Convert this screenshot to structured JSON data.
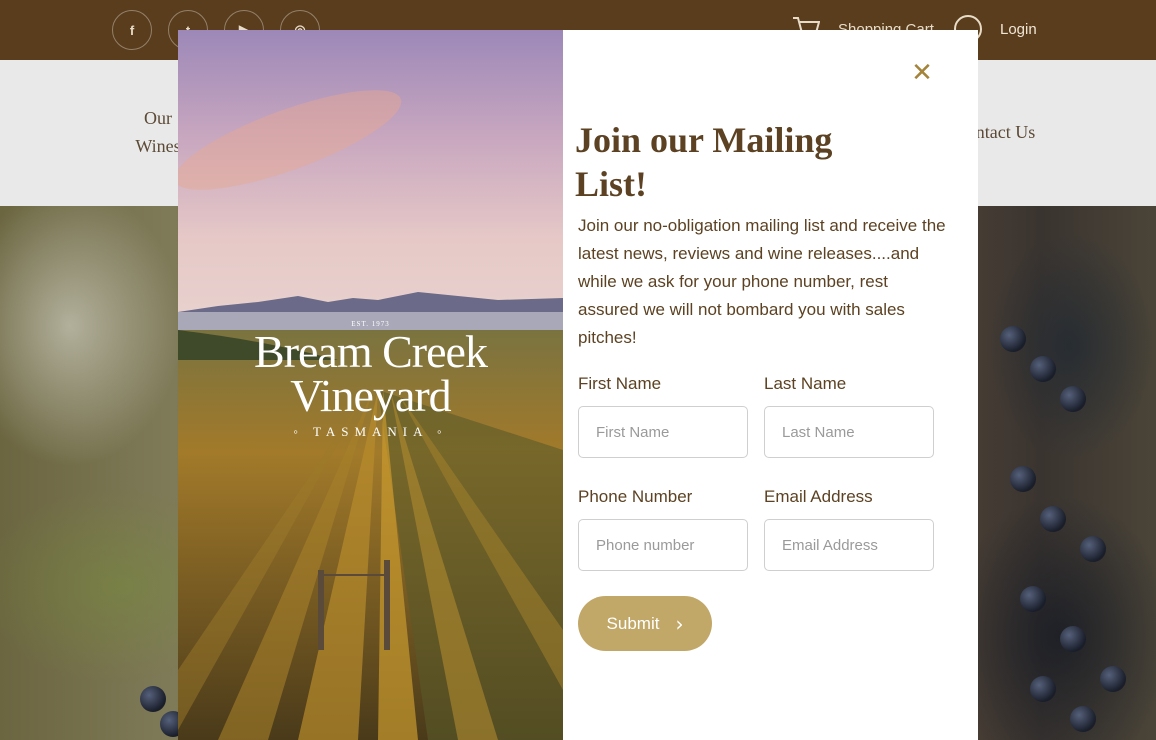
{
  "header": {
    "social_icons": [
      {
        "name": "facebook-icon",
        "glyph": "f"
      },
      {
        "name": "twitter-icon",
        "glyph": "t"
      },
      {
        "name": "youtube-icon",
        "glyph": "▶"
      },
      {
        "name": "instagram-icon",
        "glyph": "◎"
      }
    ],
    "cart_label": "Shopping Cart",
    "login_label": "Login"
  },
  "nav": {
    "items": [
      {
        "label": "Our Wines"
      },
      {
        "label": "Contact Us"
      }
    ]
  },
  "modal": {
    "logo": {
      "est": "EST. 1973",
      "line1": "Bream Creek",
      "line2": "Vineyard",
      "place": "◦ TASMANIA ◦"
    },
    "close_icon": "✕",
    "title": "Join our Mailing List!",
    "description": "Join our no-obligation mailing list and receive the latest news, reviews and wine releases....and while we ask for your phone number, rest assured we will not bombard you with sales pitches!",
    "fields": {
      "first_name": {
        "label": "First Name",
        "placeholder": "First Name",
        "value": ""
      },
      "last_name": {
        "label": "Last Name",
        "placeholder": "Last Name",
        "value": ""
      },
      "phone": {
        "label": "Phone Number",
        "placeholder": "Phone number",
        "value": ""
      },
      "email": {
        "label": "Email Address",
        "placeholder": "Email Address",
        "value": ""
      }
    },
    "submit_label": "Submit",
    "submit_icon": "›"
  },
  "colors": {
    "header_bg": "#5a3d1c",
    "title_text": "#5c4222",
    "accent_gold": "#c2a868",
    "close_gold": "#a4843a"
  }
}
